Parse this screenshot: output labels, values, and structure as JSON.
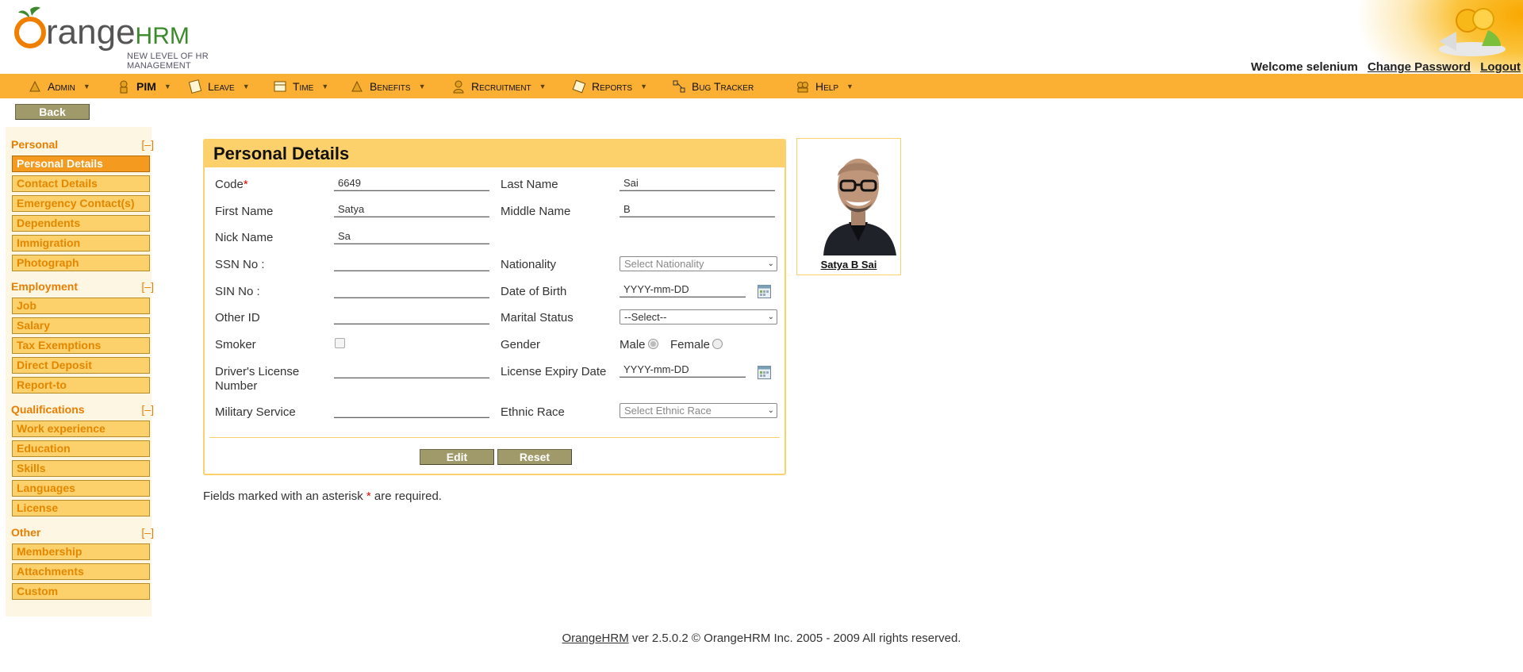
{
  "header": {
    "logo_word": "range",
    "logo_hrm": "HRM",
    "logo_tagline": "NEW LEVEL OF HR MANAGEMENT",
    "welcome": "Welcome selenium",
    "change_password": "Change Password",
    "logout": "Logout"
  },
  "menu": [
    {
      "label": "Admin",
      "icon": "admin-icon"
    },
    {
      "label": "PIM",
      "icon": "pim-icon"
    },
    {
      "label": "Leave",
      "icon": "leave-icon"
    },
    {
      "label": "Time",
      "icon": "time-icon"
    },
    {
      "label": "Benefits",
      "icon": "benefits-icon"
    },
    {
      "label": "Recruitment",
      "icon": "recruitment-icon"
    },
    {
      "label": "Reports",
      "icon": "reports-icon"
    },
    {
      "label": "Bug Tracker",
      "icon": "bug-tracker-icon"
    },
    {
      "label": "Help",
      "icon": "help-icon"
    }
  ],
  "back_label": "Back",
  "sidebar": {
    "toggle": "[–]",
    "groups": [
      {
        "title": "Personal",
        "items": [
          "Personal Details",
          "Contact Details",
          "Emergency Contact(s)",
          "Dependents",
          "Immigration",
          "Photograph"
        ]
      },
      {
        "title": "Employment",
        "items": [
          "Job",
          "Salary",
          "Tax Exemptions",
          "Direct Deposit",
          "Report-to"
        ]
      },
      {
        "title": "Qualifications",
        "items": [
          "Work experience",
          "Education",
          "Skills",
          "Languages",
          "License"
        ]
      },
      {
        "title": "Other",
        "items": [
          "Membership",
          "Attachments",
          "Custom"
        ]
      }
    ],
    "active_item": "Personal Details"
  },
  "form": {
    "title": "Personal Details",
    "code_label": "Code",
    "code_required_mark": "*",
    "code": "6649",
    "last_name_label": "Last Name",
    "last_name": "Sai",
    "first_name_label": "First Name",
    "first_name": "Satya",
    "middle_name_label": "Middle Name",
    "middle_name": "B",
    "nick_name_label": "Nick Name",
    "nick_name": "Sa",
    "ssn_label": "SSN No :",
    "ssn": "",
    "nationality_label": "Nationality",
    "nationality": "Select Nationality",
    "sin_label": "SIN No :",
    "sin": "",
    "dob_label": "Date of Birth",
    "dob": "YYYY-mm-DD",
    "other_id_label": "Other ID",
    "other_id": "",
    "marital_status_label": "Marital Status",
    "marital_status": "--Select--",
    "smoker_label": "Smoker",
    "smoker": false,
    "gender_label": "Gender",
    "gender_male": "Male",
    "gender_female": "Female",
    "dl_label_line1": "Driver's License",
    "dl_label_line2": "Number",
    "dl_number": "",
    "license_expiry_label": "License Expiry Date",
    "license_expiry": "YYYY-mm-DD",
    "military_label": "Military Service",
    "military": "",
    "ethnic_label": "Ethnic Race",
    "ethnic": "Select Ethnic Race",
    "edit_label": "Edit",
    "reset_label": "Reset"
  },
  "required_note": {
    "before": "Fields marked with an asterisk ",
    "mark": "*",
    "after": " are required."
  },
  "photo": {
    "name": "Satya B Sai"
  },
  "footer": {
    "link": "OrangeHRM",
    "text": " ver 2.5.0.2 © OrangeHRM Inc. 2005 - 2009 All rights reserved."
  },
  "colors": {
    "menu_bar": "#fbb034",
    "panel_header": "#fcd06a",
    "sidebar_active": "#f39a1f",
    "sidebar_text": "#e38700",
    "button": "#a09a6a"
  }
}
